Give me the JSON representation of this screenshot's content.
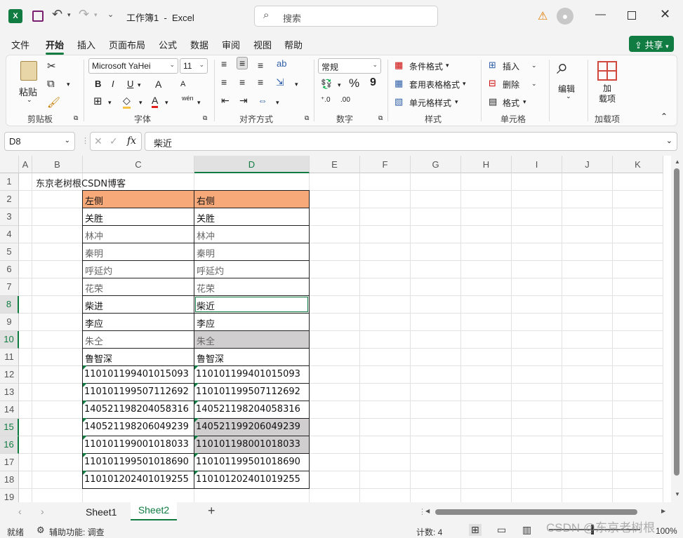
{
  "titlebar": {
    "title": "工作簿1  -  Excel",
    "search_placeholder": "搜索"
  },
  "tabs": [
    "文件",
    "开始",
    "插入",
    "页面布局",
    "公式",
    "数据",
    "审阅",
    "视图",
    "帮助"
  ],
  "share_label": "共享",
  "ribbon": {
    "paste": "粘贴",
    "clipboard": "剪贴板",
    "font_name": "Microsoft YaHei",
    "font_size": "11",
    "font": "字体",
    "bold": "B",
    "italic": "I",
    "underline": "U",
    "font_grow": "A",
    "font_shrink": "A",
    "wen": "wén",
    "alignment": "对齐方式",
    "number_format": "常规",
    "number": "数字",
    "percent": "%",
    "comma": "9",
    "cond_format": "条件格式",
    "table_format": "套用表格格式",
    "cell_style": "单元格样式",
    "styles": "样式",
    "insert": "插入",
    "delete": "删除",
    "format": "格式",
    "cells": "单元格",
    "edit": "编辑",
    "addins": "加\n载项",
    "addins_group": "加载项"
  },
  "formula_bar": {
    "name_box": "D8",
    "fx": "fx",
    "content": "柴近"
  },
  "columns": [
    "A",
    "B",
    "C",
    "D",
    "E",
    "F",
    "G",
    "H",
    "I",
    "J",
    "K"
  ],
  "rows": [
    "1",
    "2",
    "3",
    "4",
    "5",
    "6",
    "7",
    "8",
    "9",
    "10",
    "11",
    "12",
    "13",
    "14",
    "15",
    "16",
    "17",
    "18",
    "19"
  ],
  "cells": {
    "B1": "东京老树根CSDN博客",
    "C": [
      "左侧",
      "关胜",
      "林冲",
      "秦明",
      "呼延灼",
      "花荣",
      "柴进",
      "李应",
      "朱仝",
      "鲁智深",
      "110101199401015093",
      "110101199507112692",
      "140521198204058316",
      "140521198206049239",
      "110101199001018033",
      "110101199501018690",
      "110101202401019255"
    ],
    "D": [
      "右侧",
      "关胜",
      "林冲",
      "秦明",
      "呼延灼",
      "花荣",
      "柴近",
      "李应",
      "朱全",
      "鲁智深",
      "110101199401015093",
      "110101199507112692",
      "140521198204058316",
      "140521199206049239",
      "110101198001018033",
      "110101199501018690",
      "110101202401019255"
    ]
  },
  "sheets": [
    "Sheet1",
    "Sheet2"
  ],
  "active_sheet": "Sheet2",
  "status": {
    "ready": "就绪",
    "accessibility": "辅助功能: 调查",
    "count": "计数: 4",
    "zoom": "100%",
    "watermark": "CSDN @东京老树根"
  },
  "colors": {
    "header_fill": "#f8a97a",
    "highlight_fill": "#d0cece",
    "accent": "#107c41"
  }
}
